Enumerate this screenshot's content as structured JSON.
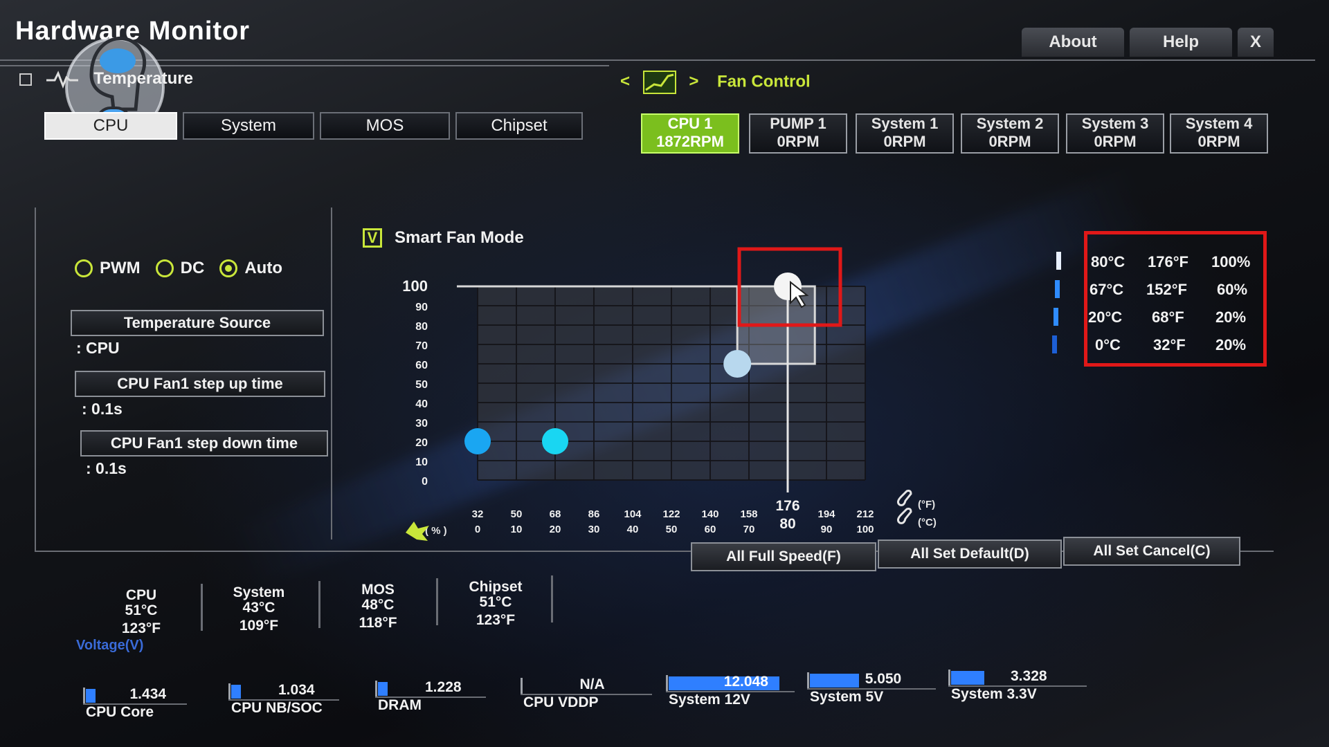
{
  "app": {
    "title": "Hardware Monitor"
  },
  "top_buttons": {
    "about": "About",
    "help": "Help",
    "close": "X"
  },
  "temperature": {
    "section_label": "Temperature",
    "tabs": [
      "CPU",
      "System",
      "MOS",
      "Chipset"
    ],
    "active_tab": 0
  },
  "fan_control": {
    "section_label": "Fan Control",
    "nav_prev": "<",
    "nav_next": ">",
    "tabs": [
      {
        "name": "CPU 1",
        "rpm": "1872RPM"
      },
      {
        "name": "PUMP 1",
        "rpm": "0RPM"
      },
      {
        "name": "System 1",
        "rpm": "0RPM"
      },
      {
        "name": "System 2",
        "rpm": "0RPM"
      },
      {
        "name": "System 3",
        "rpm": "0RPM"
      },
      {
        "name": "System 4",
        "rpm": "0RPM"
      }
    ],
    "active_tab": 0
  },
  "mode": {
    "pwm": "PWM",
    "dc": "DC",
    "auto": "Auto",
    "selected": "Auto"
  },
  "settings": {
    "temp_source_label": "Temperature Source",
    "temp_source_value": ": CPU",
    "step_up_label": "CPU Fan1 step up time",
    "step_up_value": ": 0.1s",
    "step_down_label": "CPU Fan1 step down time",
    "step_down_value": ": 0.1s"
  },
  "smart_fan": {
    "label": "Smart Fan Mode",
    "checked": true,
    "check_glyph": "V"
  },
  "chart_data": {
    "type": "line",
    "y_ticks": [
      "100",
      "90",
      "80",
      "70",
      "60",
      "50",
      "40",
      "30",
      "20",
      "10",
      "0"
    ],
    "x_ticks_f": [
      "32",
      "50",
      "68",
      "86",
      "104",
      "122",
      "140",
      "158",
      "176",
      "194",
      "212"
    ],
    "x_ticks_c": [
      "0",
      "10",
      "20",
      "30",
      "40",
      "50",
      "60",
      "70",
      "80",
      "90",
      "100"
    ],
    "unit_f": "(°F)",
    "unit_c": "(°C)",
    "y_unit": "( % )",
    "points": [
      {
        "c": 0,
        "pct": 20
      },
      {
        "c": 20,
        "pct": 20
      },
      {
        "c": 67,
        "pct": 60
      },
      {
        "c": 80,
        "pct": 100
      }
    ],
    "cursor_c": 80,
    "ylim": [
      0,
      100
    ],
    "xlim_c": [
      0,
      100
    ],
    "highlight_tick_f": "176",
    "highlight_tick_c": "80"
  },
  "curve_table": [
    {
      "c": "80°C",
      "f": "176°F",
      "pct": "100%"
    },
    {
      "c": "67°C",
      "f": "152°F",
      "pct": "60%"
    },
    {
      "c": "20°C",
      "f": "68°F",
      "pct": "20%"
    },
    {
      "c": "0°C",
      "f": "32°F",
      "pct": "20%"
    }
  ],
  "actions": {
    "full_speed": "All Full Speed(F)",
    "set_default": "All Set Default(D)",
    "set_cancel": "All Set Cancel(C)"
  },
  "sensors": [
    {
      "name": "CPU",
      "c": "51°C",
      "f": "123°F"
    },
    {
      "name": "System",
      "c": "43°C",
      "f": "109°F"
    },
    {
      "name": "MOS",
      "c": "48°C",
      "f": "118°F"
    },
    {
      "name": "Chipset",
      "c": "51°C",
      "f": "123°F"
    }
  ],
  "voltage": {
    "label": "Voltage(V)",
    "items": [
      {
        "name": "CPU Core",
        "value": "1.434",
        "level": 0.1
      },
      {
        "name": "CPU NB/SOC",
        "value": "1.034",
        "level": 0.07
      },
      {
        "name": "DRAM",
        "value": "1.228",
        "level": 0.08
      },
      {
        "name": "CPU VDDP",
        "value": "N/A",
        "level": 0
      },
      {
        "name": "System 12V",
        "value": "12.048",
        "level": 0.9
      },
      {
        "name": "System 5V",
        "value": "5.050",
        "level": 0.4
      },
      {
        "name": "System 3.3V",
        "value": "3.328",
        "level": 0.25
      }
    ]
  },
  "colors": {
    "accent_green": "#7bbf1e",
    "radio_green": "#c9e63a",
    "highlight_red": "#e01818",
    "bar_blue": "#2f7fff"
  }
}
